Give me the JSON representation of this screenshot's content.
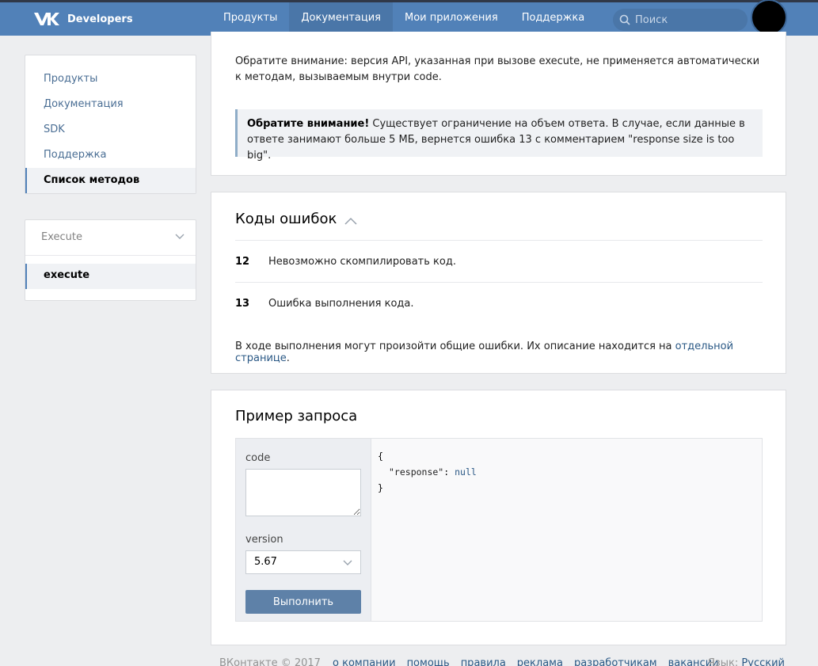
{
  "header": {
    "brand": "Developers",
    "nav": [
      "Продукты",
      "Документация",
      "Мои приложения",
      "Поддержка"
    ],
    "search_placeholder": "Поиск"
  },
  "sidebar": {
    "items": [
      "Продукты",
      "Документация",
      "SDK",
      "Поддержка",
      "Список методов"
    ],
    "section_label": "Execute",
    "method": "execute"
  },
  "notes": {
    "version_note": "Обратите внимание: версия API, указанная при вызове execute, не применяется автоматически к методам, вызываемым внутри code.",
    "alert_bold": "Обратите внимание!",
    "alert_text": " Существует ограничение на объем ответа. В случае, если данные в ответе занимают больше 5 МБ, вернется ошибка 13 с комментарием \"response size is too big\"."
  },
  "errors": {
    "title": "Коды ошибок",
    "rows": [
      {
        "code": "12",
        "desc": "Невозможно скомпилировать код."
      },
      {
        "code": "13",
        "desc": "Ошибка выполнения кода."
      }
    ],
    "footer_text": "В ходе выполнения могут произойти общие ошибки. Их описание находится на ",
    "footer_link": "отдельной странице",
    "footer_end": "."
  },
  "example": {
    "title": "Пример запроса",
    "code_label": "code",
    "version_label": "version",
    "version_value": "5.67",
    "run_label": "Выполнить",
    "response_open": "{",
    "response_key": "\"response\"",
    "response_colon": ": ",
    "response_value": "null",
    "response_close": "}"
  },
  "footer": {
    "copyright": "ВКонтакте © 2017",
    "links": [
      "о компании",
      "помощь",
      "правила",
      "реклама",
      "разработчикам",
      "вакансии"
    ],
    "lang_label": "Язык:",
    "lang_value": "Русский"
  },
  "colors": {
    "header": "#5181b8",
    "accent": "#5181b8",
    "link": "#2a5885"
  }
}
